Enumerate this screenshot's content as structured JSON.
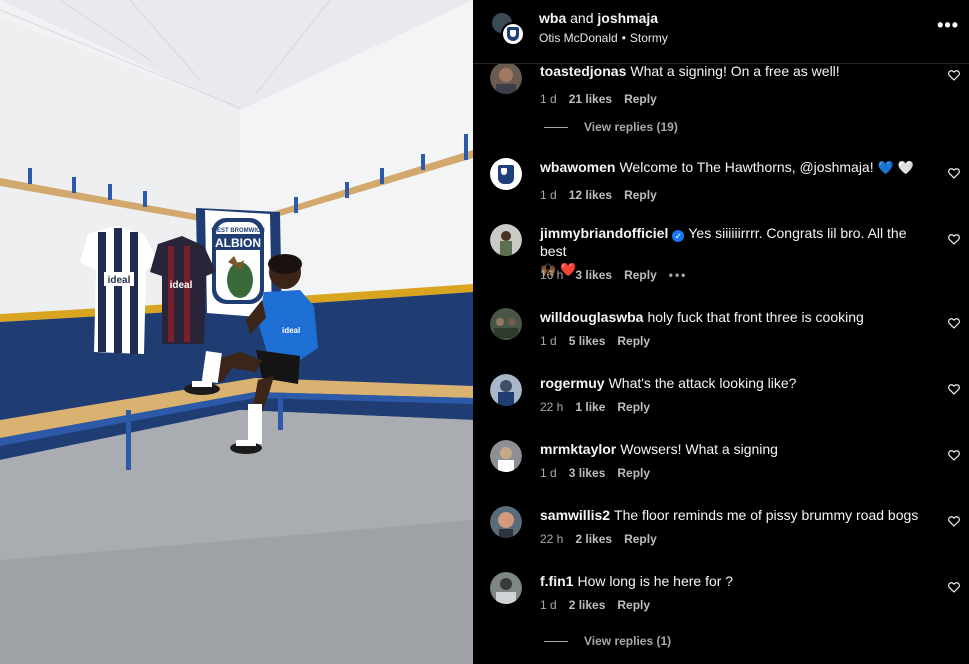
{
  "post": {
    "owner_primary": "wba",
    "owner_joiner": "and",
    "owner_secondary": "joshmaja",
    "audio_artist": "Otis McDonald",
    "audio_separator": "•",
    "audio_track": "Stormy",
    "more_icon": "more-horizontal-icon",
    "more_label": "•••"
  },
  "photo": {
    "banner_text_top": "WEST BROMWICH",
    "banner_text_main": "ALBION",
    "shirt1_sponsor": "ideal",
    "shirt2_sponsor": "ideal",
    "player_shirt_sponsor": "ideal",
    "colors": {
      "wall": "#e9ecef",
      "stripe": "#d9a521",
      "lower_wall": "#1f3d73",
      "floor": "#a6a9ad",
      "bench": "#d9b271"
    }
  },
  "comments": [
    {
      "user": "toastedjonas",
      "text": "What a signing! On a free as well!",
      "time": "1 d",
      "likes": "21 likes",
      "reply": "Reply",
      "avatar_color": "#6b5c4f"
    },
    {
      "view_replies": "View replies (19)"
    },
    {
      "user": "wbawomen",
      "text": "Welcome to The Hawthorns, @joshmaja!",
      "emoji": "💙 🤍",
      "time": "1 d",
      "likes": "12 likes",
      "reply": "Reply",
      "avatar_color": "#ffffff"
    },
    {
      "user": "jimmybriandofficiel",
      "verified": "✓",
      "text": "Yes siiiiiirrrr. Congrats lil bro. All the best",
      "emoji": "🙌🏾 ❤️",
      "time": "16 h",
      "likes": "3 likes",
      "reply": "Reply",
      "more": "•••",
      "avatar_color": "#7c8b78"
    },
    {
      "user": "willdouglaswba",
      "text": "holy fuck that front three is cooking",
      "time": "1 d",
      "likes": "5 likes",
      "reply": "Reply",
      "avatar_color": "#4a5547"
    },
    {
      "user": "rogermuy",
      "text": "What's the attack looking like?",
      "time": "22 h",
      "likes": "1 like",
      "reply": "Reply",
      "avatar_color": "#5b6f86"
    },
    {
      "user": "mrmktaylor",
      "text": "Wowsers! What a signing",
      "time": "1 d",
      "likes": "3 likes",
      "reply": "Reply",
      "avatar_color": "#8d8f94"
    },
    {
      "user": "samwillis2",
      "text": "The floor reminds me of pissy brummy road bogs",
      "time": "22 h",
      "likes": "2 likes",
      "reply": "Reply",
      "avatar_color": "#a7705a"
    },
    {
      "user": "f.fin1",
      "text": "How long is he here for ?",
      "time": "1 d",
      "likes": "2 likes",
      "reply": "Reply",
      "avatar_color": "#7f8783"
    },
    {
      "view_replies": "View replies (1)"
    }
  ]
}
